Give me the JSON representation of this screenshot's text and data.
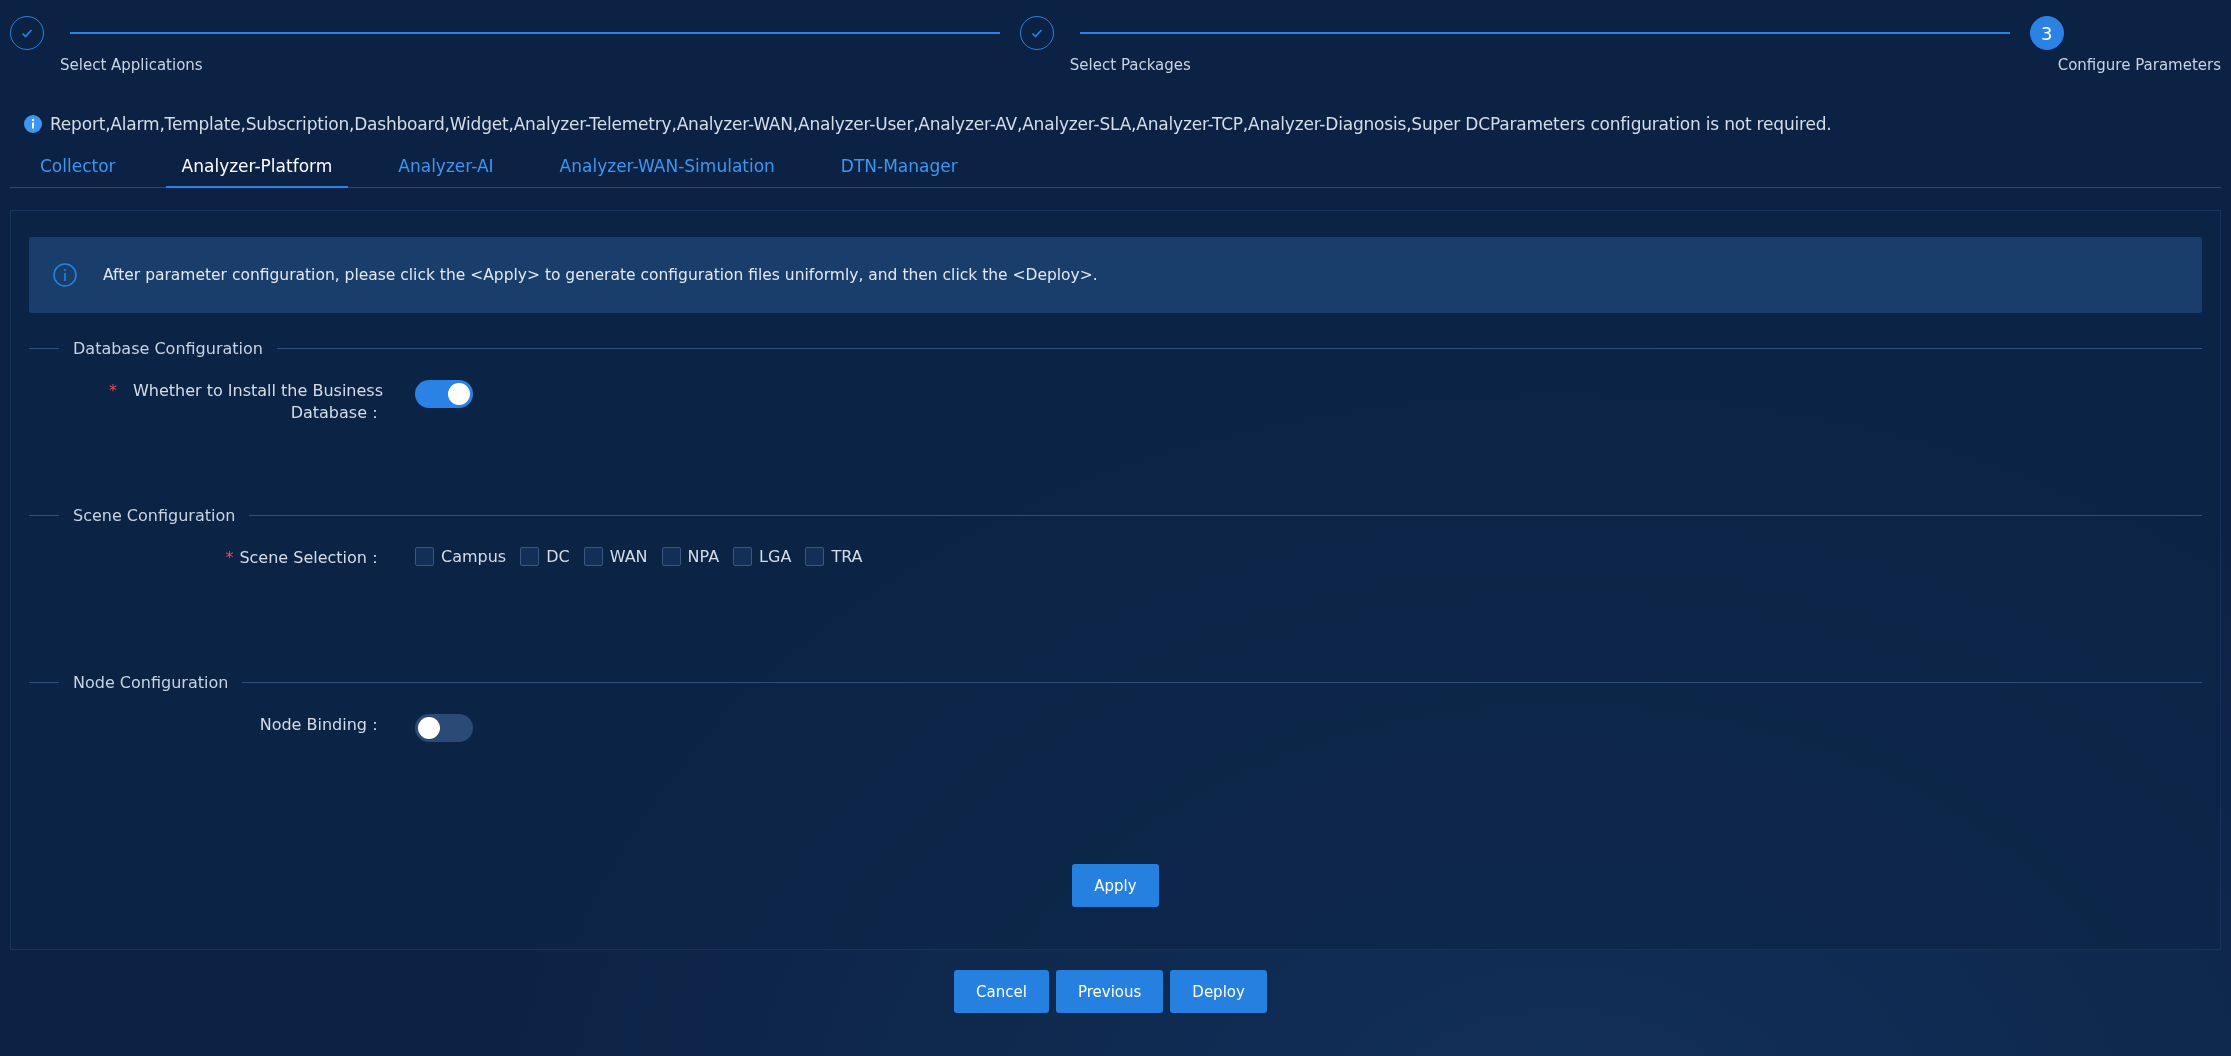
{
  "steps": [
    {
      "label": "Select Applications",
      "done": true
    },
    {
      "label": "Select Packages",
      "done": true
    },
    {
      "label": "Configure Parameters",
      "done": false,
      "number": "3"
    }
  ],
  "notice": "Report,Alarm,Template,Subscription,Dashboard,Widget,Analyzer-Telemetry,Analyzer-WAN,Analyzer-User,Analyzer-AV,Analyzer-SLA,Analyzer-TCP,Analyzer-Diagnosis,Super DCParameters configuration is not required.",
  "tabs": [
    {
      "label": "Collector",
      "selected": false
    },
    {
      "label": "Analyzer-Platform",
      "selected": true
    },
    {
      "label": "Analyzer-AI",
      "selected": false
    },
    {
      "label": "Analyzer-WAN-Simulation",
      "selected": false
    },
    {
      "label": "DTN-Manager",
      "selected": false
    }
  ],
  "banner": "After parameter configuration, please click the <Apply> to generate configuration files uniformly, and then click the <Deploy>.",
  "sections": [
    {
      "title": "Database Configuration",
      "fields": [
        {
          "kind": "switch",
          "label": "Whether to Install the Business Database：",
          "required_mark": "*",
          "on": true
        }
      ]
    },
    {
      "title": "Scene Configuration",
      "fields": [
        {
          "kind": "checkboxes",
          "label": "Scene Selection：",
          "required_mark": "*",
          "options": [
            {
              "label": "Campus",
              "checked": false
            },
            {
              "label": "DC",
              "checked": false
            },
            {
              "label": "WAN",
              "checked": false
            },
            {
              "label": "NPA",
              "checked": false
            },
            {
              "label": "LGA",
              "checked": false
            },
            {
              "label": "TRA",
              "checked": false
            }
          ]
        }
      ]
    },
    {
      "title": "Node Configuration",
      "fields": [
        {
          "kind": "switch",
          "label": "Node Binding：",
          "on": false
        }
      ]
    }
  ],
  "apply_button": "Apply",
  "footer_buttons": [
    "Cancel",
    "Previous",
    "Deploy"
  ]
}
